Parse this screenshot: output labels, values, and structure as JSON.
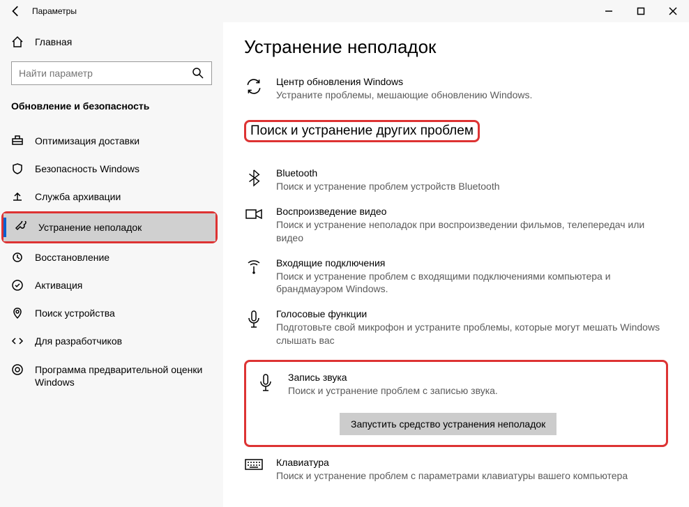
{
  "titlebar": {
    "title": "Параметры"
  },
  "sidebar": {
    "home_label": "Главная",
    "search_placeholder": "Найти параметр",
    "section": "Обновление и безопасность",
    "items": [
      {
        "label": "Оптимизация доставки"
      },
      {
        "label": "Безопасность Windows"
      },
      {
        "label": "Служба архивации"
      },
      {
        "label": "Устранение неполадок"
      },
      {
        "label": "Восстановление"
      },
      {
        "label": "Активация"
      },
      {
        "label": "Поиск устройства"
      },
      {
        "label": "Для разработчиков"
      },
      {
        "label": "Программа предварительной оценки Windows"
      }
    ]
  },
  "content": {
    "page_title": "Устранение неполадок",
    "wu": {
      "title": "Центр обновления Windows",
      "desc": "Устраните проблемы, мешающие обновлению Windows."
    },
    "section2": "Поиск и устранение других проблем",
    "bt": {
      "title": "Bluetooth",
      "desc": "Поиск и устранение проблем устройств Bluetooth"
    },
    "video": {
      "title": "Воспроизведение видео",
      "desc": "Поиск и устранение неполадок при воспроизведении фильмов, телепередач или видео"
    },
    "incoming": {
      "title": "Входящие подключения",
      "desc": "Поиск и устранение проблем с входящими подключениями компьютера и брандмауэром Windows."
    },
    "voice": {
      "title": "Голосовые функции",
      "desc": "Подготовьте свой микрофон и устраните проблемы, которые могут мешать Windows слышать вас"
    },
    "record": {
      "title": "Запись звука",
      "desc": "Поиск и устранение проблем с записью звука.",
      "button": "Запустить средство устранения неполадок"
    },
    "keyboard": {
      "title": "Клавиатура",
      "desc": "Поиск и устранение проблем с параметрами клавиатуры вашего компьютера"
    }
  }
}
